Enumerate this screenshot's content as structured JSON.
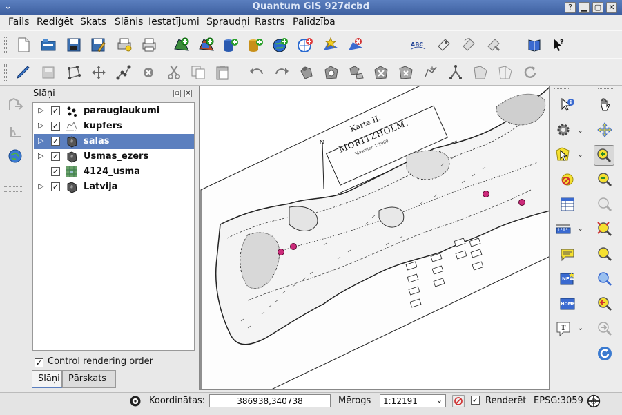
{
  "window": {
    "title": "Quantum GIS 927dcbd",
    "menu_glyph": "⌄",
    "help_glyph": "?",
    "minimize_glyph": "▁",
    "maximize_glyph": "▢",
    "close_glyph": "✕"
  },
  "menubar": [
    "Fails",
    "Rediģēt",
    "Skats",
    "Slānis",
    "Iestatījumi",
    "Spraudņi",
    "Rastrs",
    "Palīdzība"
  ],
  "layers_panel": {
    "title": "Slāņi",
    "layers": [
      {
        "name": "parauglaukumi",
        "expander": "▷",
        "checked": "✓",
        "icon": "points-layer-icon"
      },
      {
        "name": "kupfers",
        "expander": "▷",
        "checked": "✓",
        "icon": "raster-layer-icon"
      },
      {
        "name": "salas",
        "expander": "▷",
        "checked": "✓",
        "icon": "polygon-layer-icon"
      },
      {
        "name": "Usmas_ezers",
        "expander": "▷",
        "checked": "✓",
        "icon": "polygon-layer-icon"
      },
      {
        "name": "4124_usma",
        "expander": "",
        "checked": "✓",
        "icon": "raster-layer-icon"
      },
      {
        "name": "Latvija",
        "expander": "▷",
        "checked": "✓",
        "icon": "polygon-layer-icon"
      }
    ],
    "selected_layer": "salas",
    "control_rendering_order": {
      "label": "Control rendering order",
      "checked": "✓"
    },
    "tabs": [
      "Slāņi",
      "Pārskats"
    ],
    "active_tab": "Slāņi"
  },
  "map": {
    "title_line1": "Karte II.",
    "title_line2": "MORITZHOLM.",
    "scale_note": "Massstab 1:1000"
  },
  "statusbar": {
    "coord_label": "Koordinātas:",
    "coord_value": "386938,340738",
    "scale_label": "Mērogs",
    "scale_value": "1:12191",
    "render_label": "Renderēt",
    "render_checked": "✓",
    "crs": "EPSG:3059"
  },
  "colors": {
    "titlebar": "#4a6eae",
    "selection": "#5b7fbf",
    "map_points": "#cc2a7a"
  }
}
